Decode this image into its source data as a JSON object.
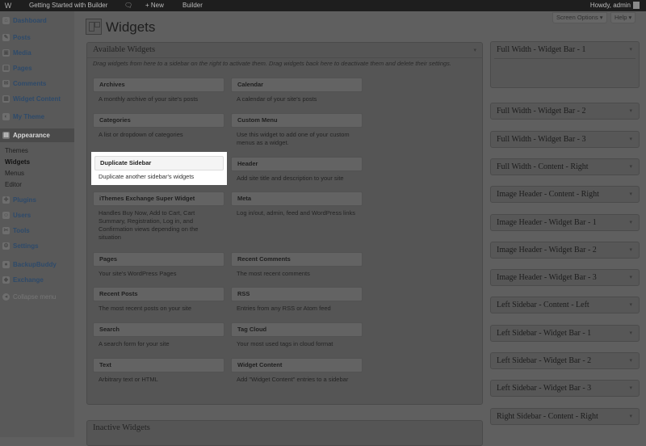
{
  "admin_bar": {
    "wp_logo": "W",
    "site_name": "Getting Started with Builder",
    "comments_icon": "speech-bubble",
    "new_label": "+ New",
    "builder_label": "Builder",
    "howdy": "Howdy, admin"
  },
  "screen_options": "Screen Options ▾",
  "help": "Help ▾",
  "page_title": "Widgets",
  "menu": [
    {
      "label": "Dashboard",
      "icon": "dashboard-icon",
      "glyph": "⌂"
    },
    {
      "label": "Posts",
      "icon": "pin-icon",
      "glyph": "✎"
    },
    {
      "label": "Media",
      "icon": "media-icon",
      "glyph": "▣"
    },
    {
      "label": "Pages",
      "icon": "pages-icon",
      "glyph": "▤"
    },
    {
      "label": "Comments",
      "icon": "comment-icon",
      "glyph": "✉"
    },
    {
      "label": "Widget Content",
      "icon": "widget-content-icon",
      "glyph": "▦"
    },
    {
      "label": "My Theme",
      "icon": "theme-icon",
      "glyph": "◐"
    },
    {
      "label": "Appearance",
      "icon": "appearance-icon",
      "glyph": "▤"
    },
    {
      "label": "Plugins",
      "icon": "plugin-icon",
      "glyph": "✚"
    },
    {
      "label": "Users",
      "icon": "users-icon",
      "glyph": "☺"
    },
    {
      "label": "Tools",
      "icon": "tools-icon",
      "glyph": "✂"
    },
    {
      "label": "Settings",
      "icon": "settings-icon",
      "glyph": "⚙"
    },
    {
      "label": "BackupBuddy",
      "icon": "backupbuddy-icon",
      "glyph": "●"
    },
    {
      "label": "Exchange",
      "icon": "exchange-icon",
      "glyph": "◆"
    },
    {
      "label": "Collapse menu",
      "icon": "collapse-icon",
      "glyph": "◂"
    }
  ],
  "submenu": [
    "Themes",
    "Widgets",
    "Menus",
    "Editor"
  ],
  "available": {
    "title": "Available Widgets",
    "hint": "Drag widgets from here to a sidebar on the right to activate them. Drag widgets back here to deactivate them and delete their settings.",
    "widgets": [
      {
        "name": "Archives",
        "desc": "A monthly archive of your site's posts"
      },
      {
        "name": "Calendar",
        "desc": "A calendar of your site's posts"
      },
      {
        "name": "Categories",
        "desc": "A list or dropdown of categories"
      },
      {
        "name": "Custom Menu",
        "desc": "Use this widget to add one of your custom menus as a widget."
      },
      {
        "name": "Duplicate Sidebar",
        "desc": "Duplicate another sidebar's widgets"
      },
      {
        "name": "Header",
        "desc": "Add site title and description to your site"
      },
      {
        "name": "iThemes Exchange Super Widget",
        "desc": "Handles Buy Now, Add to Cart, Cart Summary, Registration, Log in, and Confirmation views depending on the situation"
      },
      {
        "name": "Meta",
        "desc": "Log in/out, admin, feed and WordPress links"
      },
      {
        "name": "Pages",
        "desc": "Your site's WordPress Pages"
      },
      {
        "name": "Recent Comments",
        "desc": "The most recent comments"
      },
      {
        "name": "Recent Posts",
        "desc": "The most recent posts on your site"
      },
      {
        "name": "RSS",
        "desc": "Entries from any RSS or Atom feed"
      },
      {
        "name": "Search",
        "desc": "A search form for your site"
      },
      {
        "name": "Tag Cloud",
        "desc": "Your most used tags in cloud format"
      },
      {
        "name": "Text",
        "desc": "Arbitrary text or HTML"
      },
      {
        "name": "Widget Content",
        "desc": "Add \"Widget Content\" entries to a sidebar"
      }
    ]
  },
  "inactive": {
    "title": "Inactive Widgets"
  },
  "sidebars": [
    "Full Width - Widget Bar - 1",
    "Full Width - Widget Bar - 2",
    "Full Width - Widget Bar - 3",
    "Full Width - Content - Right",
    "Image Header - Content - Right",
    "Image Header - Widget Bar - 1",
    "Image Header - Widget Bar - 2",
    "Image Header - Widget Bar - 3",
    "Left Sidebar - Content - Left",
    "Left Sidebar - Widget Bar - 1",
    "Left Sidebar - Widget Bar - 2",
    "Left Sidebar - Widget Bar - 3",
    "Right Sidebar - Content - Right"
  ],
  "arrow_glyph": "▾"
}
